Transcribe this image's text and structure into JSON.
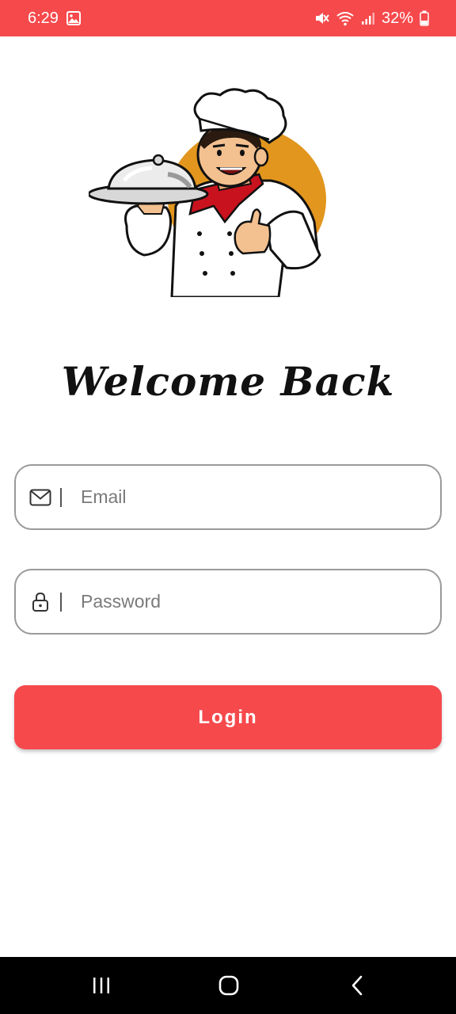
{
  "status_bar": {
    "time": "6:29",
    "battery_percent": "32%",
    "icons": [
      "image-notification-icon",
      "mute-icon",
      "wifi-icon",
      "signal-icon",
      "battery-icon"
    ]
  },
  "mascot": {
    "icon": "chef-mascot-illustration"
  },
  "welcome": {
    "title": "Welcome Back"
  },
  "email": {
    "placeholder": "Email",
    "value": "",
    "icon": "mail-icon"
  },
  "password": {
    "placeholder": "Password",
    "value": "",
    "icon": "lock-icon"
  },
  "login": {
    "label": "Login"
  },
  "nav": {
    "icons": [
      "recents-icon",
      "home-icon",
      "back-icon"
    ]
  },
  "colors": {
    "accent": "#f6494c",
    "border": "#9a9a9a",
    "mascot_circle": "#e2961e",
    "scarf": "#c8121e"
  }
}
